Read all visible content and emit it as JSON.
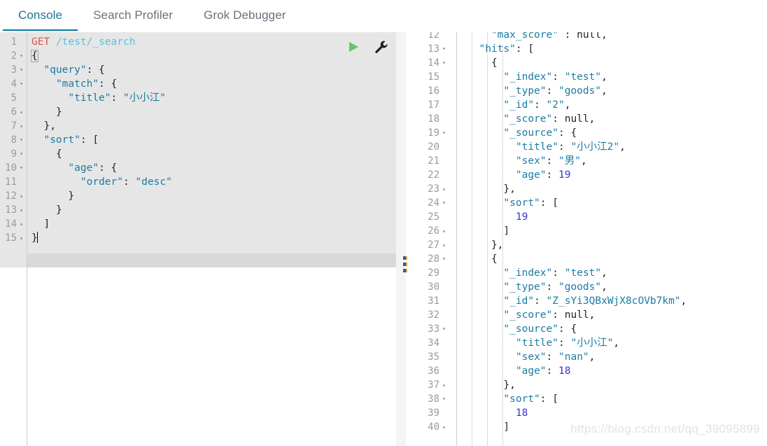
{
  "tabs": [
    {
      "label": "Console",
      "active": true
    },
    {
      "label": "Search Profiler",
      "active": false
    },
    {
      "label": "Grok Debugger",
      "active": false
    }
  ],
  "accent_color": "#017d9e",
  "toolbar": {
    "run_label": "Run request",
    "wrench_label": "Request options"
  },
  "request_editor": {
    "first_line_number": 1,
    "active_line": 15,
    "lines": [
      {
        "n": 1,
        "fold": "",
        "text": "GET /test/_search"
      },
      {
        "n": 2,
        "fold": "▾",
        "text": "{"
      },
      {
        "n": 3,
        "fold": "▾",
        "text": "  \"query\": {"
      },
      {
        "n": 4,
        "fold": "▾",
        "text": "    \"match\": {"
      },
      {
        "n": 5,
        "fold": "",
        "text": "      \"title\": \"小小江\""
      },
      {
        "n": 6,
        "fold": "▴",
        "text": "    }"
      },
      {
        "n": 7,
        "fold": "▴",
        "text": "  },"
      },
      {
        "n": 8,
        "fold": "▾",
        "text": "  \"sort\": ["
      },
      {
        "n": 9,
        "fold": "▾",
        "text": "    {"
      },
      {
        "n": 10,
        "fold": "▾",
        "text": "      \"age\": {"
      },
      {
        "n": 11,
        "fold": "",
        "text": "        \"order\": \"desc\""
      },
      {
        "n": 12,
        "fold": "▴",
        "text": "      }"
      },
      {
        "n": 13,
        "fold": "▴",
        "text": "    }"
      },
      {
        "n": 14,
        "fold": "▴",
        "text": "  ]"
      },
      {
        "n": 15,
        "fold": "▴",
        "text": "}"
      }
    ],
    "method": "GET",
    "path": "/test/_search",
    "query_body": {
      "query": {
        "match": {
          "title": "小小江"
        }
      },
      "sort": [
        {
          "age": {
            "order": "desc"
          }
        }
      ]
    }
  },
  "response_editor": {
    "first_line_number": 12,
    "last_line_number": 40,
    "lines": [
      {
        "n": 12,
        "fold": "",
        "text": "    \"max_score\" : null,"
      },
      {
        "n": 13,
        "fold": "▾",
        "text": "  \"hits\": ["
      },
      {
        "n": 14,
        "fold": "▾",
        "text": "    {"
      },
      {
        "n": 15,
        "fold": "",
        "text": "      \"_index\": \"test\","
      },
      {
        "n": 16,
        "fold": "",
        "text": "      \"_type\": \"goods\","
      },
      {
        "n": 17,
        "fold": "",
        "text": "      \"_id\": \"2\","
      },
      {
        "n": 18,
        "fold": "",
        "text": "      \"_score\": null,"
      },
      {
        "n": 19,
        "fold": "▾",
        "text": "      \"_source\": {"
      },
      {
        "n": 20,
        "fold": "",
        "text": "        \"title\": \"小小江2\","
      },
      {
        "n": 21,
        "fold": "",
        "text": "        \"sex\": \"男\","
      },
      {
        "n": 22,
        "fold": "",
        "text": "        \"age\": 19"
      },
      {
        "n": 23,
        "fold": "▴",
        "text": "      },"
      },
      {
        "n": 24,
        "fold": "▾",
        "text": "      \"sort\": ["
      },
      {
        "n": 25,
        "fold": "",
        "text": "        19"
      },
      {
        "n": 26,
        "fold": "▴",
        "text": "      ]"
      },
      {
        "n": 27,
        "fold": "▴",
        "text": "    },"
      },
      {
        "n": 28,
        "fold": "▾",
        "text": "    {"
      },
      {
        "n": 29,
        "fold": "",
        "text": "      \"_index\": \"test\","
      },
      {
        "n": 30,
        "fold": "",
        "text": "      \"_type\": \"goods\","
      },
      {
        "n": 31,
        "fold": "",
        "text": "      \"_id\": \"Z_sYi3QBxWjX8cOVb7km\","
      },
      {
        "n": 32,
        "fold": "",
        "text": "      \"_score\": null,"
      },
      {
        "n": 33,
        "fold": "▾",
        "text": "      \"_source\": {"
      },
      {
        "n": 34,
        "fold": "",
        "text": "        \"title\": \"小小江\","
      },
      {
        "n": 35,
        "fold": "",
        "text": "        \"sex\": \"nan\","
      },
      {
        "n": 36,
        "fold": "",
        "text": "        \"age\": 18"
      },
      {
        "n": 37,
        "fold": "▴",
        "text": "      },"
      },
      {
        "n": 38,
        "fold": "▾",
        "text": "      \"sort\": ["
      },
      {
        "n": 39,
        "fold": "",
        "text": "        18"
      },
      {
        "n": 40,
        "fold": "▴",
        "text": "      ]"
      }
    ],
    "hits": [
      {
        "_index": "test",
        "_type": "goods",
        "_id": "2",
        "_score": null,
        "_source": {
          "title": "小小江2",
          "sex": "男",
          "age": 19
        },
        "sort": [
          19
        ]
      },
      {
        "_index": "test",
        "_type": "goods",
        "_id": "Z_sYi3QBxWjX8cOVb7km",
        "_score": null,
        "_source": {
          "title": "小小江",
          "sex": "nan",
          "age": 18
        },
        "sort": [
          18
        ]
      }
    ],
    "max_score": null
  },
  "watermark": {
    "text": "https://blog.csdn.net/qq_39095899"
  }
}
